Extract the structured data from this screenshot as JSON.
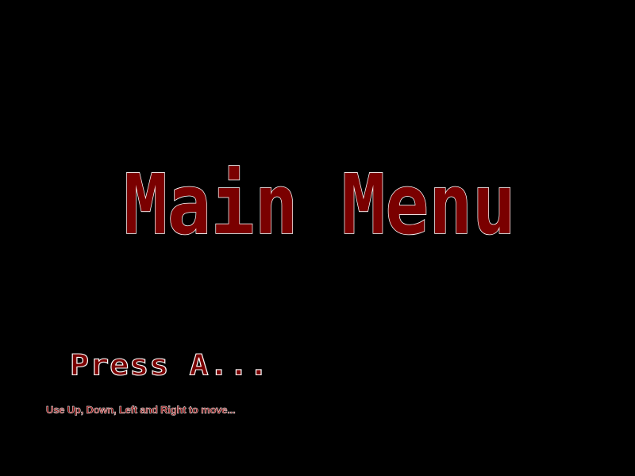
{
  "screen": {
    "title": "Main Menu",
    "prompt": "Press A...",
    "hint": "Use Up, Down, Left and Right to move..."
  },
  "colors": {
    "background": "#000000",
    "text_fill": "#7a0000",
    "text_outline": "#ffffff"
  }
}
